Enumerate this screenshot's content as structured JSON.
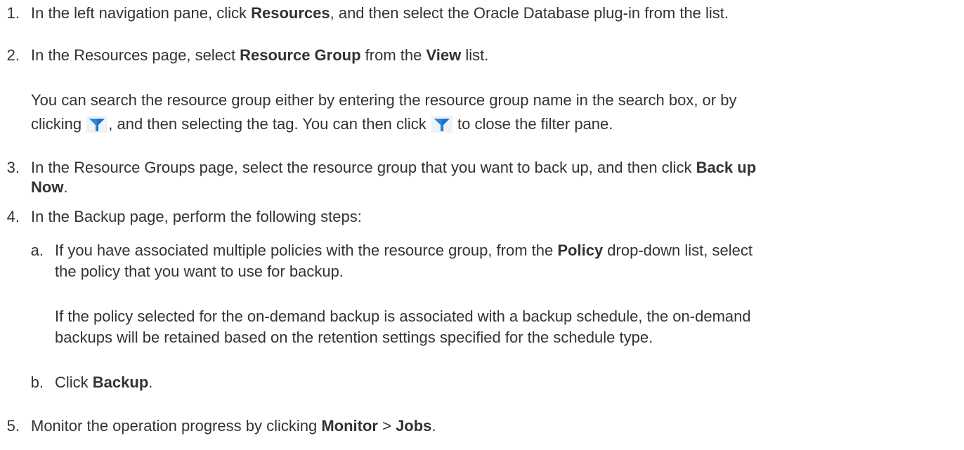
{
  "steps": [
    {
      "num": "1.",
      "text": {
        "a": "In the left navigation pane, click ",
        "b": "Resources",
        "c": ", and then select the Oracle Database plug-in from the list."
      }
    },
    {
      "num": "2.",
      "text": {
        "a": "In the Resources page, select ",
        "b": "Resource Group",
        "c": " from the ",
        "d": "View",
        "e": " list."
      },
      "note": {
        "line1": "You can search the resource group either by entering the resource group name in the search box, or by",
        "line2_a": "clicking ",
        "line2_b": ", and then selecting the tag. You can then click ",
        "line2_c": " to close the filter pane."
      }
    },
    {
      "num": "3.",
      "text": {
        "a": "In the Resource Groups page, select the resource group that you want to back up, and then click ",
        "b": "Back up",
        "c": "Now",
        "d": "."
      }
    },
    {
      "num": "4.",
      "text": "In the Backup page, perform the following steps:",
      "substeps": [
        {
          "letter": "a.",
          "line1_a": "If you have associated multiple policies with the resource group, from the ",
          "line1_b": "Policy",
          "line1_c": " drop-down list, select",
          "line2": "the policy that you want to use for backup.",
          "note_line1": "If the policy selected for the on-demand backup is associated with a backup schedule, the on-demand",
          "note_line2": "backups will be retained based on the retention settings specified for the schedule type."
        },
        {
          "letter": "b.",
          "a": "Click ",
          "b": "Backup",
          "c": "."
        }
      ]
    },
    {
      "num": "5.",
      "text": {
        "a": "Monitor the operation progress by clicking ",
        "b": "Monitor",
        "c": " > ",
        "d": "Jobs",
        "e": "."
      }
    }
  ],
  "icons": {
    "filter": "filter-icon",
    "filter_color": "#1a73c8"
  }
}
